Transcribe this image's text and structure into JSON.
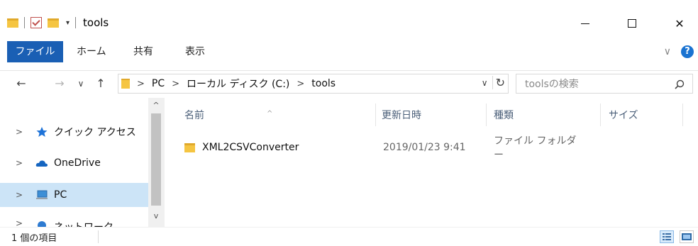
{
  "window": {
    "title": "tools",
    "minimize": "—",
    "maximize": "☐",
    "close": "✕"
  },
  "quick_access_toolbar": {
    "dropdown": "▾",
    "separator": "|"
  },
  "ribbon": {
    "tabs": [
      {
        "label": "ファイル",
        "active": true
      },
      {
        "label": "ホーム",
        "active": false
      },
      {
        "label": "共有",
        "active": false
      },
      {
        "label": "表示",
        "active": false
      }
    ],
    "collapse_chevron": "∨",
    "help": "?"
  },
  "navigation": {
    "back": "←",
    "forward": "→",
    "recent": "∨",
    "up": "↑"
  },
  "address_bar": {
    "breadcrumbs": [
      "PC",
      "ローカル ディスク (C:)",
      "tools"
    ],
    "separator": ">",
    "dropdown": "∨",
    "refresh": "↻"
  },
  "search": {
    "placeholder": "toolsの検索"
  },
  "nav_pane": {
    "items": [
      {
        "label": "クイック アクセス",
        "icon": "star-icon",
        "selected": false
      },
      {
        "label": "OneDrive",
        "icon": "cloud-icon",
        "selected": false
      },
      {
        "label": "PC",
        "icon": "computer-icon",
        "selected": true
      },
      {
        "label": "ネットワーク",
        "icon": "network-icon",
        "selected": false
      }
    ],
    "expand_chevron": ">",
    "scroll_up": "^",
    "scroll_down": "v"
  },
  "file_list": {
    "columns": [
      "名前",
      "更新日時",
      "種類",
      "サイズ"
    ],
    "sort_indicator": "^",
    "rows": [
      {
        "name": "XML2CSVConverter",
        "modified": "2019/01/23 9:41",
        "type": "ファイル フォルダー",
        "size": ""
      }
    ]
  },
  "status_bar": {
    "item_count": "1 個の項目"
  },
  "colors": {
    "accent": "#1a5fb4",
    "selection": "#cce4f7",
    "folder": "#f5c542",
    "header_text": "#4c607a"
  }
}
